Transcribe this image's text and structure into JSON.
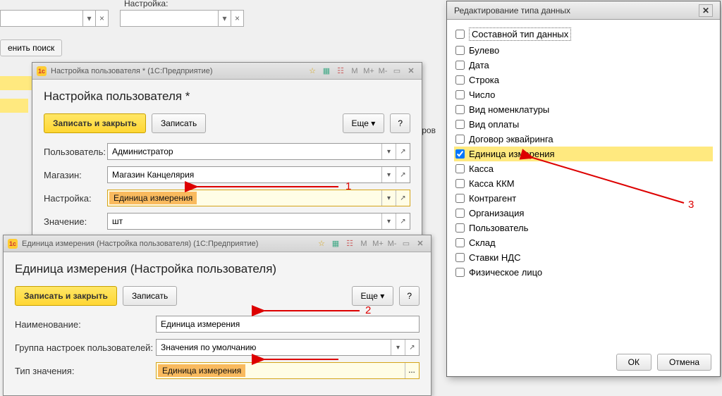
{
  "bg": {
    "setting_label": "Настройка:",
    "search_btn": "енить поиск",
    "goods_text": "ки товаров"
  },
  "win1": {
    "title": "Настройка пользователя * (1С:Предприятие)",
    "heading": "Настройка пользователя *",
    "save_close": "Записать и закрыть",
    "save": "Записать",
    "more": "Еще",
    "help": "?",
    "user_label": "Пользователь:",
    "user_value": "Администратор",
    "shop_label": "Магазин:",
    "shop_value": "Магазин Канцелярия",
    "setting_label": "Настройка:",
    "setting_value": "Единица измерения",
    "value_label": "Значение:",
    "value_value": "шт"
  },
  "win2": {
    "title": "Единица измерения (Настройка пользователя) (1С:Предприятие)",
    "heading": "Единица измерения (Настройка пользователя)",
    "save_close": "Записать и закрыть",
    "save": "Записать",
    "more": "Еще",
    "help": "?",
    "name_label": "Наименование:",
    "name_value": "Единица измерения",
    "group_label": "Группа настроек пользователей:",
    "group_value": "Значения по умолчанию",
    "type_label": "Тип значения:",
    "type_value": "Единица измерения"
  },
  "dlg": {
    "title": "Редактирование типа данных",
    "composite": "Составной тип данных",
    "types": [
      {
        "label": "Булево",
        "checked": false
      },
      {
        "label": "Дата",
        "checked": false
      },
      {
        "label": "Строка",
        "checked": false
      },
      {
        "label": "Число",
        "checked": false
      },
      {
        "label": "Вид номенклатуры",
        "checked": false
      },
      {
        "label": "Вид оплаты",
        "checked": false
      },
      {
        "label": "Договор эквайринга",
        "checked": false
      },
      {
        "label": "Единица измерения",
        "checked": true
      },
      {
        "label": "Касса",
        "checked": false
      },
      {
        "label": "Касса ККМ",
        "checked": false
      },
      {
        "label": "Контрагент",
        "checked": false
      },
      {
        "label": "Организация",
        "checked": false
      },
      {
        "label": "Пользователь",
        "checked": false
      },
      {
        "label": "Склад",
        "checked": false
      },
      {
        "label": "Ставки НДС",
        "checked": false
      },
      {
        "label": "Физическое лицо",
        "checked": false
      }
    ],
    "ok": "ОК",
    "cancel": "Отмена"
  },
  "ann": {
    "1": "1",
    "2": "2",
    "3": "3"
  }
}
